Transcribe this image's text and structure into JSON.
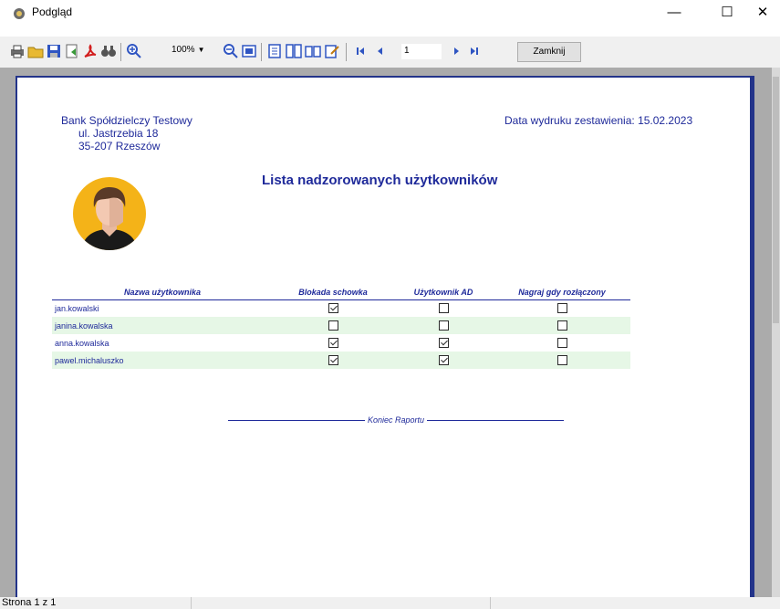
{
  "window": {
    "title": "Podgląd",
    "minimize_glyph": "—",
    "maximize_glyph": "☐",
    "close_glyph": "✕"
  },
  "toolbar": {
    "zoom_value": "100%",
    "zoom_arrow": "▼",
    "page_number": "1",
    "close_label": "Zamknij",
    "icons": [
      "print-icon",
      "open-icon",
      "save-icon",
      "export-icon",
      "pdf-icon",
      "find-icon",
      "zoom-in-icon",
      "zoom-out-icon",
      "whole-page-icon",
      "single-page-icon",
      "multi-page-icon",
      "open-book-icon",
      "edit-page-icon",
      "first-page-icon",
      "prev-page-icon",
      "next-page-icon",
      "last-page-icon"
    ]
  },
  "report": {
    "bank_name": "Bank Spółdzielczy Testowy",
    "bank_street": "ul. Jastrzebia 18",
    "bank_city": "35-207 Rzeszów",
    "date_line": "Data wydruku zestawienia: 15.02.2023",
    "title": "Lista nadzorowanych użytkowników",
    "columns": [
      "Nazwa użytkownika",
      "Blokada schowka",
      "Użytkownik AD",
      "Nagraj gdy rozłączony"
    ],
    "rows": [
      {
        "name": "jan.kowalski",
        "blokada": true,
        "ad": false,
        "nagraj": false
      },
      {
        "name": "janina.kowalska",
        "blokada": false,
        "ad": false,
        "nagraj": false
      },
      {
        "name": "anna.kowalska",
        "blokada": true,
        "ad": true,
        "nagraj": false
      },
      {
        "name": "pawel.michaluszko",
        "blokada": true,
        "ad": true,
        "nagraj": false
      }
    ],
    "end_label": "Koniec Raportu"
  },
  "status": {
    "page_info": "Strona 1 z 1"
  },
  "colors": {
    "report_text": "#1f2a9a",
    "alt_row": "#e6f7e6",
    "preview_bg": "#ababab"
  }
}
